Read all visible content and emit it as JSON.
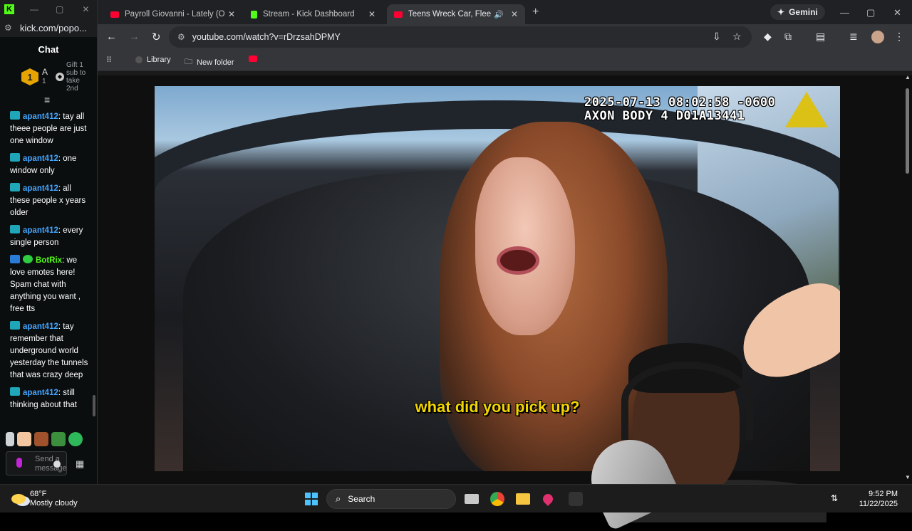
{
  "kick_window": {
    "url": "kick.com/popo...",
    "chat_title": "Chat",
    "pinned": {
      "badge": "1",
      "user_initial": "A",
      "user_count": "1",
      "gift_text": "Gift 1 sub to take 2nd"
    },
    "messages": [
      {
        "user": "apant412",
        "text": ": tay all theee people are just one window"
      },
      {
        "user": "apant412",
        "text": ": one window only"
      },
      {
        "user": "apant412",
        "text": ": all these people x years older"
      },
      {
        "user": "apant412",
        "text": ": every single person"
      },
      {
        "user": "BotRix",
        "text": ": we love emotes here! Spam chat with anything you want , free tts"
      },
      {
        "user": "apant412",
        "text": ": tay remember that underground world yesterday the tunnels that was crazy deep"
      },
      {
        "user": "apant412",
        "text": ": still thinking about that"
      }
    ],
    "send_placeholder": "Send a message"
  },
  "browser": {
    "tabs": [
      {
        "label": "Payroll Giovanni - Lately (Officia",
        "favicon_color": "#ff0033"
      },
      {
        "label": "Stream - Kick Dashboard",
        "favicon_color": "#53fc18"
      },
      {
        "label": "Teens Wreck Car, Flee and",
        "favicon_color": "#ff0033"
      }
    ],
    "gemini_label": "Gemini",
    "url": "youtube.com/watch?v=rDrzsahDPMY",
    "bookmarks": [
      {
        "label": "Library"
      },
      {
        "label": "New folder"
      }
    ]
  },
  "video": {
    "osd_line1": "2025-07-13 08:02:58 -0600",
    "osd_line2": "AXON BODY 4 D01A13441",
    "subtitle": "what did you pick up?"
  },
  "taskbar": {
    "temperature": "68°F",
    "weather": "Mostly cloudy",
    "search_label": "Search",
    "time": "9:52 PM",
    "date": "11/22/2025"
  }
}
